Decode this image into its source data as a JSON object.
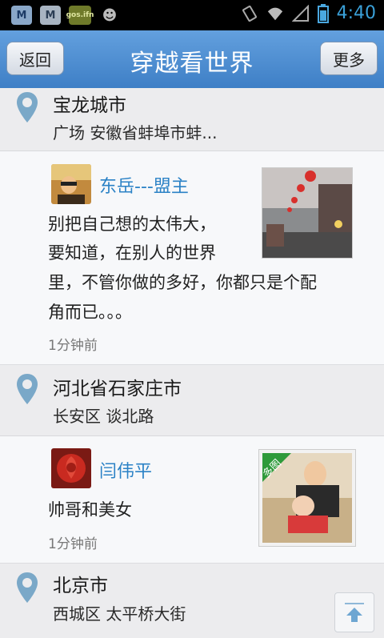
{
  "status_bar": {
    "time": "4:40",
    "notification_icons": [
      "m-icon",
      "m-icon-2",
      "news-icon",
      "android-icon"
    ],
    "notif_text": [
      "M",
      "M",
      "gos.ifn",
      "☻"
    ]
  },
  "title_bar": {
    "back_label": "返回",
    "title": "穿越看世界",
    "more_label": "更多"
  },
  "feed": [
    {
      "location_line1": "宝龙城市",
      "location_line2": "广场 安徽省蚌埠市蚌..."
    },
    {
      "user_name": "东岳---盟主",
      "text_line1": "别把自己想的太伟大，",
      "text_line2": "要知道，在别人的世界",
      "text_line3": "里，不管你做的多好，你都只是个配",
      "text_line4": "角而已。。。",
      "time": "1分钟前"
    },
    {
      "location_line1": "河北省石家庄市",
      "location_line2": "长安区 谈北路"
    },
    {
      "user_name": "闫伟平",
      "text_line1": "帅哥和美女",
      "time": "1分钟前",
      "badge": "多图"
    },
    {
      "location_line1": "北京市",
      "location_line2": "西城区 太平桥大街"
    }
  ],
  "colors": {
    "title_bar_top": "#63a0de",
    "title_bar_bottom": "#3e7fc6",
    "user_name": "#2b82c6",
    "clock": "#3aa0d8"
  }
}
